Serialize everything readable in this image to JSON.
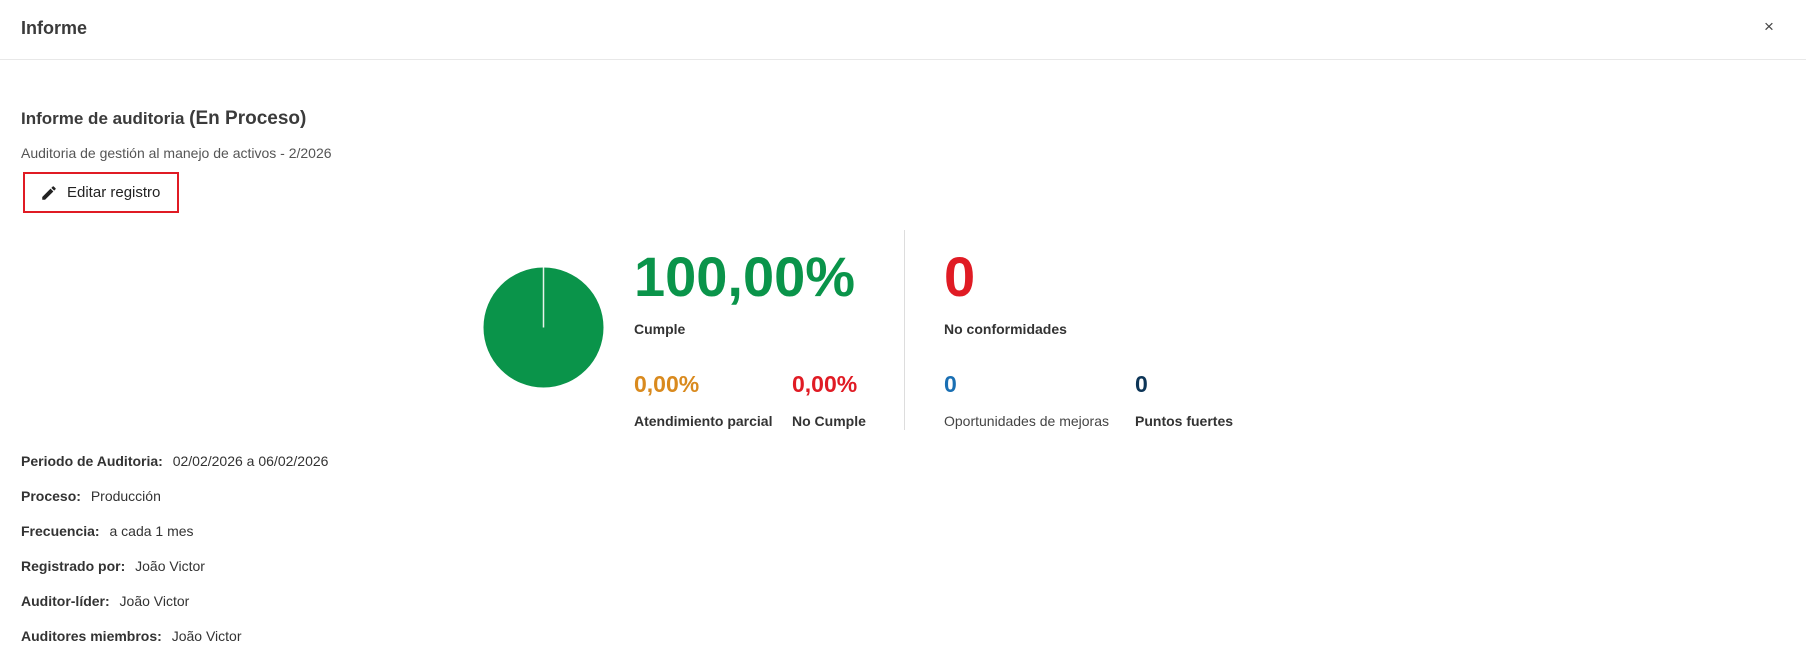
{
  "header": {
    "title": "Informe",
    "close_label": "×"
  },
  "report": {
    "title": "Informe de auditoria",
    "status": "(En Proceso)",
    "subtitle": "Auditoria de gestión al manejo de activos - 2/2026",
    "edit_label": "Editar registro"
  },
  "summary": {
    "cumple": {
      "value": "100,00%",
      "label": "Cumple"
    },
    "parcial": {
      "value": "0,00%",
      "label": "Atendimiento parcial"
    },
    "no_cumple": {
      "value": "0,00%",
      "label": "No Cumple"
    },
    "no_conformidades": {
      "value": "0",
      "label": "No conformidades"
    },
    "oportunidades": {
      "value": "0",
      "label": "Oportunidades de mejoras"
    },
    "puntos_fuertes": {
      "value": "0",
      "label": "Puntos fuertes"
    }
  },
  "pie": {
    "cumple_fraction": 1.0,
    "parcial_fraction": 0.0,
    "no_cumple_fraction": 0.0
  },
  "colors": {
    "green": "#0a944a",
    "orange": "#d98a1e",
    "red": "#e01b24",
    "blue": "#1a6fb3",
    "navy": "#0d3557"
  },
  "details": [
    {
      "key": "Periodo de Auditoria:",
      "value": "02/02/2026 a 06/02/2026"
    },
    {
      "key": "Proceso:",
      "value": "Producción"
    },
    {
      "key": "Frecuencia:",
      "value": "a cada 1 mes"
    },
    {
      "key": "Registrado por:",
      "value": "João Victor"
    },
    {
      "key": "Auditor-líder:",
      "value": "João Victor"
    },
    {
      "key": "Auditores miembros:",
      "value": "João Victor"
    }
  ]
}
